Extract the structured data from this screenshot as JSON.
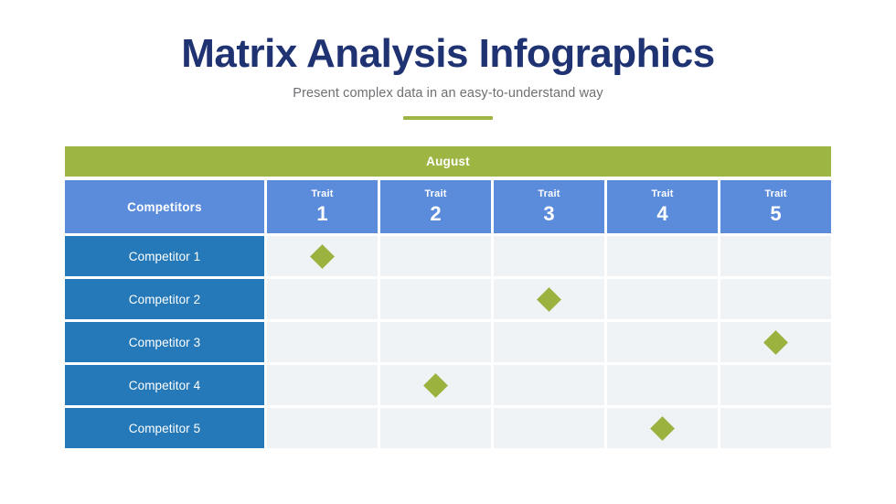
{
  "header": {
    "title": "Matrix Analysis Infographics",
    "subtitle": "Present complex data in an easy-to-understand way"
  },
  "matrix": {
    "month_label": "August",
    "corner_label": "Competitors",
    "trait_word": "Trait",
    "columns": [
      {
        "word": "Trait",
        "number": "1"
      },
      {
        "word": "Trait",
        "number": "2"
      },
      {
        "word": "Trait",
        "number": "3"
      },
      {
        "word": "Trait",
        "number": "4"
      },
      {
        "word": "Trait",
        "number": "5"
      }
    ],
    "rows": [
      {
        "label": "Competitor 1",
        "marks": [
          true,
          false,
          false,
          false,
          false
        ]
      },
      {
        "label": "Competitor 2",
        "marks": [
          false,
          false,
          true,
          false,
          false
        ]
      },
      {
        "label": "Competitor 3",
        "marks": [
          false,
          false,
          false,
          false,
          true
        ]
      },
      {
        "label": "Competitor 4",
        "marks": [
          false,
          true,
          false,
          false,
          false
        ]
      },
      {
        "label": "Competitor 5",
        "marks": [
          false,
          false,
          false,
          true,
          false
        ]
      }
    ]
  },
  "colors": {
    "title": "#1f3272",
    "subtitle": "#6f6f73",
    "accent_green": "#9db542",
    "header_blue": "#5b8cdc",
    "row_blue": "#2579b8",
    "cell_bg": "#eff3f6",
    "marker_green": "#9cb23e"
  }
}
